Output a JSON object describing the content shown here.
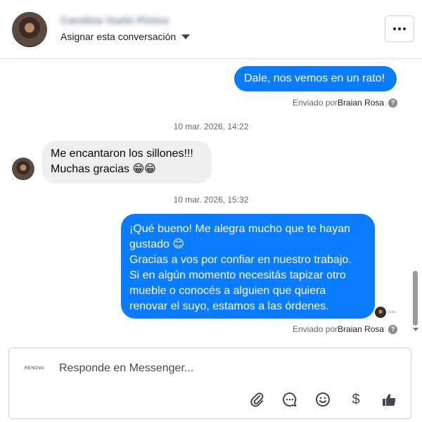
{
  "header": {
    "contact_name": "Carolina Vuelo Pintos",
    "assign_label": "Asignar esta conversación",
    "more_label": "..."
  },
  "messages": [
    {
      "type": "outgoing",
      "text": "Dale, nos vemos en un rato!"
    },
    {
      "type": "sent_by",
      "prefix": "Enviado por",
      "author": "Braian Rosa"
    },
    {
      "type": "timestamp",
      "text": "10 mar. 2026, 14:22"
    },
    {
      "type": "incoming",
      "lines": [
        "Me encantaron los sillones!!!",
        "Muchas gracias 😁😁"
      ]
    },
    {
      "type": "timestamp",
      "text": "10 mar. 2026, 15:32"
    },
    {
      "type": "outgoing",
      "lines": [
        "¡Qué bueno! Me alegra mucho que te hayan",
        "gustado 😊",
        "Gracias a vos por confiar en nuestro trabajo.",
        "Si en algún momento necesitás tapizar otro",
        "mueble o conocés a alguien que quiera",
        "renovar el suyo, estamos a las órdenes."
      ]
    },
    {
      "type": "sent_by",
      "prefix": "Enviado por",
      "author": "Braian Rosa"
    }
  ],
  "seen_tag": "Visto",
  "composer": {
    "brand": "RENOVA",
    "placeholder": "Responde en Messenger...",
    "tools": [
      "paperclip-icon",
      "chat-bubble-icon",
      "emoji-icon",
      "dollar-icon",
      "thumbs-up-icon"
    ],
    "dollar_glyph": "$"
  }
}
